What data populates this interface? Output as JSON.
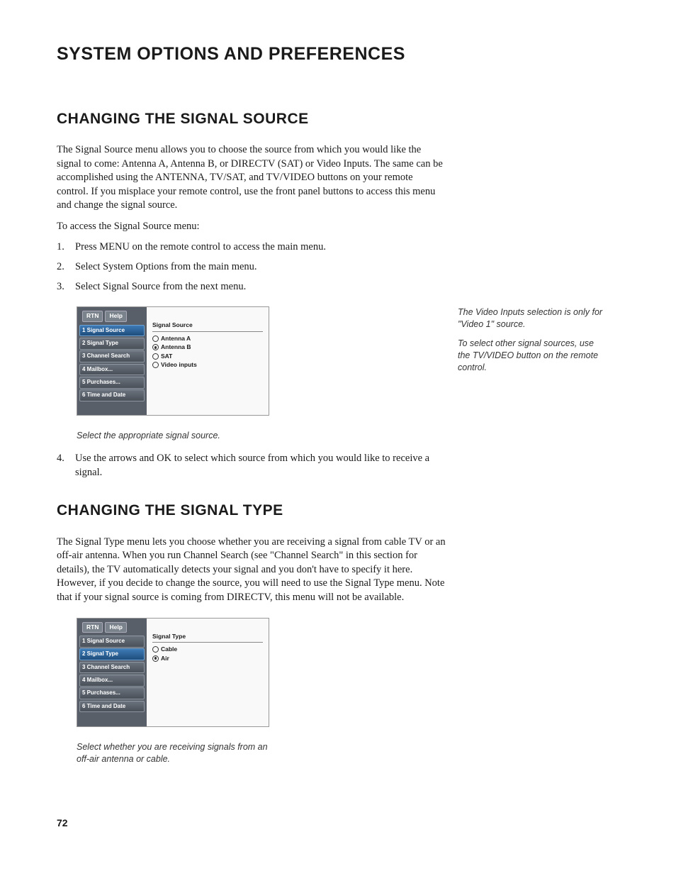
{
  "page_title": "SYSTEM OPTIONS AND PREFERENCES",
  "section1": {
    "heading": "CHANGING THE SIGNAL SOURCE",
    "para1": "The Signal Source menu allows you to choose the source from which you would like the signal to come: Antenna A, Antenna B, or DIRECTV (SAT) or Video Inputs. The same can be accomplished using the ANTENNA, TV/SAT, and TV/VIDEO buttons on your remote control. If you misplace your remote control, use the front panel buttons to access this menu and change the signal source.",
    "para2": "To access the Signal Source menu:",
    "step1": "Press MENU on the remote control to access the main menu.",
    "step2": "Select System Options from the main menu.",
    "step3": "Select Signal Source from the next menu.",
    "step4": "Use the arrows and OK to select which source from which you would like to receive a signal.",
    "caption": "Select the appropriate signal source.",
    "sidenote1": "The Video Inputs selection is only for \"Video 1\" source.",
    "sidenote2": "To select other signal sources, use the TV/VIDEO button on the remote control."
  },
  "section2": {
    "heading": "CHANGING THE SIGNAL TYPE",
    "para1": "The Signal Type menu lets you choose whether you are receiving a signal from cable TV or an off-air antenna. When you run Channel Search (see \"Channel Search\" in this section for details), the TV automatically detects your signal and you don't have to specify it here. However, if you decide to change the source, you will need to use the Signal Type menu. Note that if your signal source is coming from DIRECTV, this menu will not be available.",
    "caption": "Select whether you are receiving signals from an off-air antenna or cable."
  },
  "screenshot1": {
    "tab_rtn": "RTN",
    "tab_help": "Help",
    "side1": "1 Signal Source",
    "side2": "2 Signal Type",
    "side3": "3 Channel Search",
    "side4": "4 Mailbox...",
    "side5": "5 Purchases...",
    "side6": "6 Time and Date",
    "panel_title": "Signal Source",
    "opt1": "Antenna A",
    "opt2": "Antenna B",
    "opt3": "SAT",
    "opt4": "Video inputs"
  },
  "screenshot2": {
    "tab_rtn": "RTN",
    "tab_help": "Help",
    "side1": "1 Signal Source",
    "side2": "2 Signal Type",
    "side3": "3 Channel Search",
    "side4": "4 Mailbox...",
    "side5": "5 Purchases...",
    "side6": "6 Time and Date",
    "panel_title": "Signal Type",
    "opt1": "Cable",
    "opt2": "Air"
  },
  "page_number": "72"
}
